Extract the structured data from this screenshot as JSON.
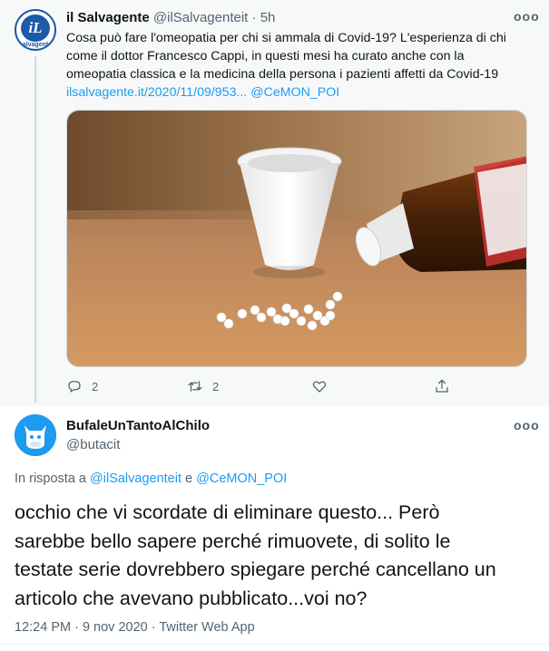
{
  "tweet1": {
    "display_name": "il Salvagente",
    "handle": "@ilSalvagenteit",
    "separator": "·",
    "time": "5h",
    "avatar_text": "iL",
    "avatar_brand": "salvagente",
    "more": "ooo",
    "text_lines": [
      "Cosa può fare l'omeopatia per chi si ammala di Covid-19? L'esperienza di chi",
      "come il dottor Francesco Cappi, in questi mesi ha curato anche con la",
      "omeopatia classica e la medicina della persona i pazienti affetti da Covid-19"
    ],
    "link": "ilsalvagente.it/2020/11/09/953...",
    "mention": "@CeMON_POI",
    "actions": {
      "reply_count": "2",
      "retweet_count": "2"
    }
  },
  "tweet2": {
    "display_name": "BufaleUnTantoAlChilo",
    "handle": "@butacit",
    "more": "ooo",
    "reply_prefix": "In risposta a",
    "reply_to_1": "@ilSalvagenteit",
    "reply_and": "e",
    "reply_to_2": "@CeMON_POI",
    "text_lines": [
      "occhio che vi scordate di eliminare questo... Però",
      "sarebbe bello sapere perché rimuovete, di solito le",
      "testate serie dovrebbero spiegare perché cancellano un",
      "articolo che avevano pubblicato...voi no?"
    ],
    "meta": "12:24 PM · 9 nov 2020 · Twitter Web App"
  },
  "colors": {
    "link": "#1d9bf0",
    "muted": "#536471",
    "text": "#0f1419"
  },
  "icons": [
    "reply-icon",
    "retweet-icon",
    "like-icon",
    "share-icon",
    "more-icon"
  ]
}
